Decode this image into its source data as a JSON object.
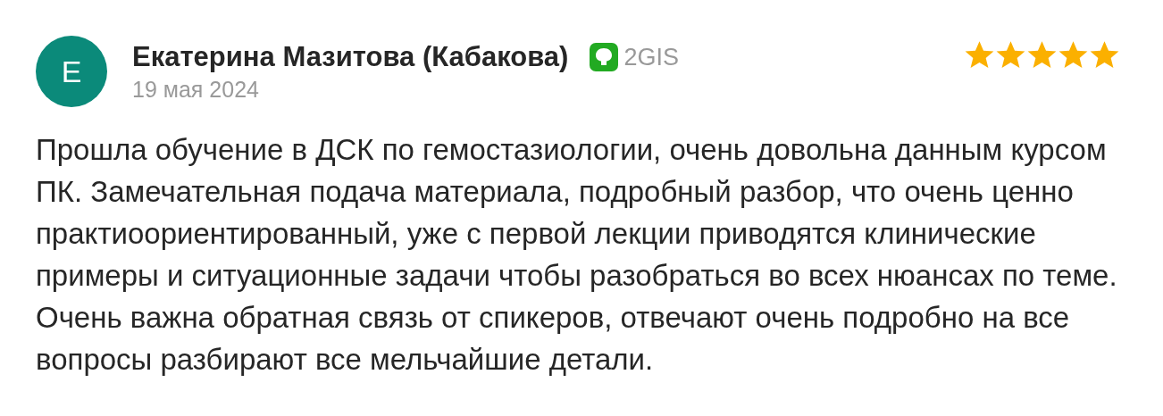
{
  "review": {
    "avatar_letter": "E",
    "author": "Екатерина Мазитова (Кабакова)",
    "source": "2GIS",
    "date": "19 мая 2024",
    "stars": 5,
    "text": "Прошла обучение в ДСК по гемостазиологии, очень довольна данным курсом ПК. Замечательная подача материала, подробный разбор, что очень ценно практиоориентированный, уже с первой лекции приводятся клинические примеры и ситуационные задачи чтобы разобраться во всех нюансах по теме. Очень важна обратная связь от спикеров, отвечают очень подробно на все вопросы разбирают все мельчайшие детали."
  }
}
